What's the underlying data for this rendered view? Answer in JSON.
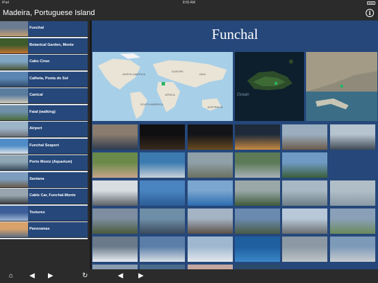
{
  "status": {
    "left": "iPad",
    "time": "8:55 AM"
  },
  "header": {
    "title": "Madeira, Portuguese Island",
    "info_icon": "info-icon"
  },
  "sidebar": {
    "items": [
      {
        "label": "Funchal",
        "colors": [
          "#6b7b91",
          "#c4a071"
        ]
      },
      {
        "label": "Botanical Garden, Monte",
        "colors": [
          "#3e5b2c",
          "#c5722f"
        ]
      },
      {
        "label": "Cabo Cirao",
        "colors": [
          "#7fa5c4",
          "#4d5c3d"
        ]
      },
      {
        "label": "Calheta, Ponta do Sol",
        "colors": [
          "#5b86b4",
          "#2f4b6b"
        ]
      },
      {
        "label": "Canical",
        "colors": [
          "#5a7d9e",
          "#d2cbb8"
        ]
      },
      {
        "label": "Faial (walking)",
        "colors": [
          "#6f8fa8",
          "#4a6b3a"
        ]
      },
      {
        "label": "Airport",
        "colors": [
          "#9eb4c8",
          "#6d7178"
        ]
      },
      {
        "label": "Funchal Seaport",
        "colors": [
          "#4f8dc8",
          "#e0e4e8"
        ]
      },
      {
        "label": "Porto Moniz (Aquarium)",
        "colors": [
          "#8fa6b5",
          "#3b4f5f"
        ]
      },
      {
        "label": "Santana",
        "colors": [
          "#7e9ec0",
          "#6b5c4a"
        ]
      },
      {
        "label": "Cable Car, Funchal-Monte",
        "colors": [
          "#98a5ae",
          "#3a3f44"
        ]
      },
      {
        "label": "Textures",
        "colors": [
          "#3b5e98",
          "#9fb6d3"
        ]
      },
      {
        "label": "Panoramas",
        "colors": [
          "#d8a26a",
          "#5c6e86"
        ]
      }
    ]
  },
  "content": {
    "title": "Funchal",
    "maps": {
      "world": [
        "NORTH AMERICA",
        "EUROPE",
        "AFRICA",
        "SOUTH AMERICA",
        "AUSTRALIA",
        "ASIA"
      ],
      "ocean_label": "Ocean"
    },
    "photos": [
      [
        "#8a7c6e",
        "#2e3a4c"
      ],
      [
        "#0f0e10",
        "#3a2a1c"
      ],
      [
        "#121418",
        "#6a4a20"
      ],
      [
        "#1e2a3a",
        "#c98a40"
      ],
      [
        "#9aaec0",
        "#6b5a4a"
      ],
      [
        "#b6c4d0",
        "#3f4a54"
      ],
      [
        "#6a8a4a",
        "#c7a48a"
      ],
      [
        "#3c7bb0",
        "#c8d2d8"
      ],
      [
        "#8fa0a8",
        "#6b7060"
      ],
      [
        "#5b7a55",
        "#a8b2b8"
      ],
      [
        "#6f9ac4",
        "#3a5e3a"
      ],
      [
        "#25477a",
        "#25477a"
      ],
      [
        "#d8dde2",
        "#5a6066"
      ],
      [
        "#4a84c0",
        "#2a5b94"
      ],
      [
        "#7aa6d0",
        "#2c6cb0"
      ],
      [
        "#9aa8a8",
        "#3f5a3a"
      ],
      [
        "#a8b8c4",
        "#6e7e86"
      ],
      [
        "#b0bec8",
        "#8a9aa4"
      ],
      [
        "#7e8ea0",
        "#4a5a3a"
      ],
      [
        "#6e8ea8",
        "#3a4a5a"
      ],
      [
        "#a4b4c4",
        "#5c5048"
      ],
      [
        "#6a8ab0",
        "#4a5a44"
      ],
      [
        "#b8c8d8",
        "#6a6e70"
      ],
      [
        "#8aa0b8",
        "#6a8a5a"
      ],
      [
        "#6a7a8a",
        "#e8ecf0"
      ],
      [
        "#5a7ea8",
        "#d8dee4"
      ],
      [
        "#9fb8d0",
        "#e4e8ec"
      ],
      [
        "#1f5fa0",
        "#3a86c8"
      ],
      [
        "#8c99a4",
        "#c0c4c8"
      ],
      [
        "#7d9ab8",
        "#c8ccd0"
      ],
      [
        "#8a9eb0",
        "#d0d4d8"
      ],
      [
        "#4a6a8a",
        "#c8ccd0"
      ],
      [
        "#c4a8a0",
        "#6e7e90"
      ],
      [
        "#2a4a6a",
        "#2a4a6a"
      ],
      [
        "#25477a",
        "#25477a"
      ],
      [
        "#25477a",
        "#25477a"
      ]
    ]
  },
  "bottom": {
    "home_icon": "home-icon",
    "back_icon": "back-icon",
    "forward_icon": "forward-icon",
    "refresh_icon": "refresh-icon"
  }
}
